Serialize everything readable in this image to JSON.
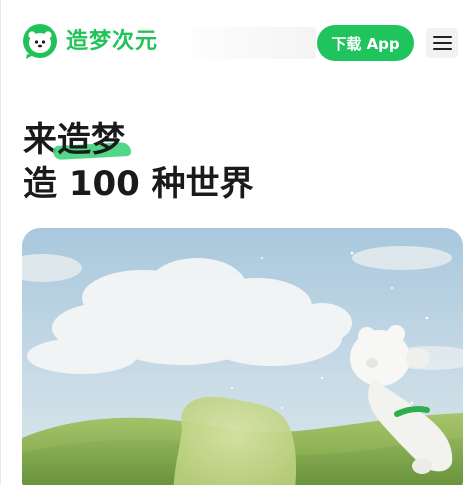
{
  "header": {
    "brand_name": "造梦次元",
    "download_label": "下载 App",
    "menu_icon": "hamburger-menu-icon",
    "logo_icon": "mascot-logo-icon"
  },
  "hero": {
    "line1_prefix": "来",
    "line1_highlight": "造梦",
    "line2": "造 100 种世界"
  },
  "banner": {
    "image_description_icon": "mascot-sky-meadow-illustration"
  },
  "colors": {
    "brand_green": "#1fc45c",
    "text_dark": "#1a1a1a"
  }
}
